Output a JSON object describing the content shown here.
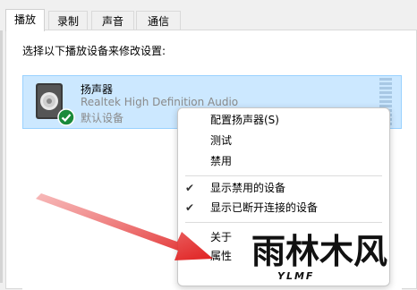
{
  "tabs": [
    {
      "label": "播放"
    },
    {
      "label": "录制"
    },
    {
      "label": "声音"
    },
    {
      "label": "通信"
    }
  ],
  "instruction": "选择以下播放设备来修改设置:",
  "device": {
    "name": "扬声器",
    "driver": "Realtek High Definition Audio",
    "status": "默认设备",
    "icon": "speaker-icon",
    "badge_icon": "default-check-icon"
  },
  "context_menu": {
    "items": [
      {
        "label": "配置扬声器(S)",
        "checked": false
      },
      {
        "label": "测试",
        "checked": false
      },
      {
        "label": "禁用",
        "checked": false
      },
      {
        "label": "显示禁用的设备",
        "checked": true
      },
      {
        "label": "显示已断开连接的设备",
        "checked": true
      },
      {
        "label": "关于",
        "checked": false
      },
      {
        "label": "属性",
        "checked": false
      }
    ]
  },
  "watermark": {
    "text": "雨林木风",
    "subtext": "YLMF"
  },
  "colors": {
    "selection": "#cce8ff",
    "arrow": "#e02020",
    "badge": "#1a8a3a"
  }
}
